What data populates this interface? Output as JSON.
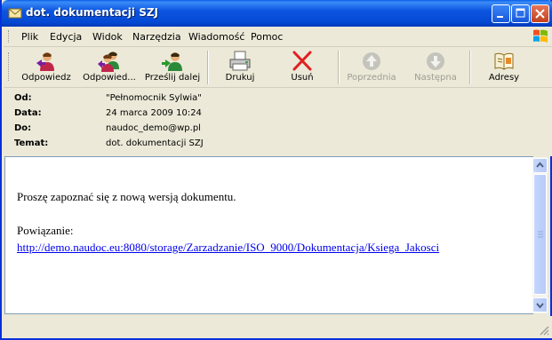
{
  "window": {
    "title": "dot. dokumentacji SZJ"
  },
  "menu": {
    "items": [
      "Plik",
      "Edycja",
      "Widok",
      "Narzędzia",
      "Wiadomość",
      "Pomoc"
    ]
  },
  "toolbar": {
    "reply": "Odpowiedz",
    "reply_all": "Odpowied...",
    "forward": "Prześlij dalej",
    "print": "Drukuj",
    "delete": "Usuń",
    "previous": "Poprzednia",
    "next": "Następna",
    "addresses": "Adresy"
  },
  "header": {
    "from_label": "Od:",
    "from_value": "\"Pełnomocnik Sylwia\"",
    "date_label": "Data:",
    "date_value": "24 marca 2009 10:24",
    "to_label": "Do:",
    "to_value": "naudoc_demo@wp.pl",
    "subject_label": "Temat:",
    "subject_value": "dot. dokumentacji SZJ"
  },
  "message": {
    "line1": "Proszę zapoznać się z nową wersją dokumentu.",
    "line2": "Powiązanie:",
    "link": "http://demo.naudoc.eu:8080/storage/Zarzadzanie/ISO_9000/Dokumentacja/Ksiega_Jakosci"
  },
  "icons": {
    "window": "envelope-icon",
    "reply": "reply-person-icon",
    "reply_all": "reply-all-people-icon",
    "forward": "forward-person-icon",
    "print": "printer-icon",
    "delete": "red-x-icon",
    "previous": "up-arrow-icon",
    "next": "down-arrow-icon",
    "addresses": "address-book-icon"
  },
  "colors": {
    "titlebar": "#0a5fe8",
    "link": "#0000ee",
    "delete_red": "#e02020"
  }
}
